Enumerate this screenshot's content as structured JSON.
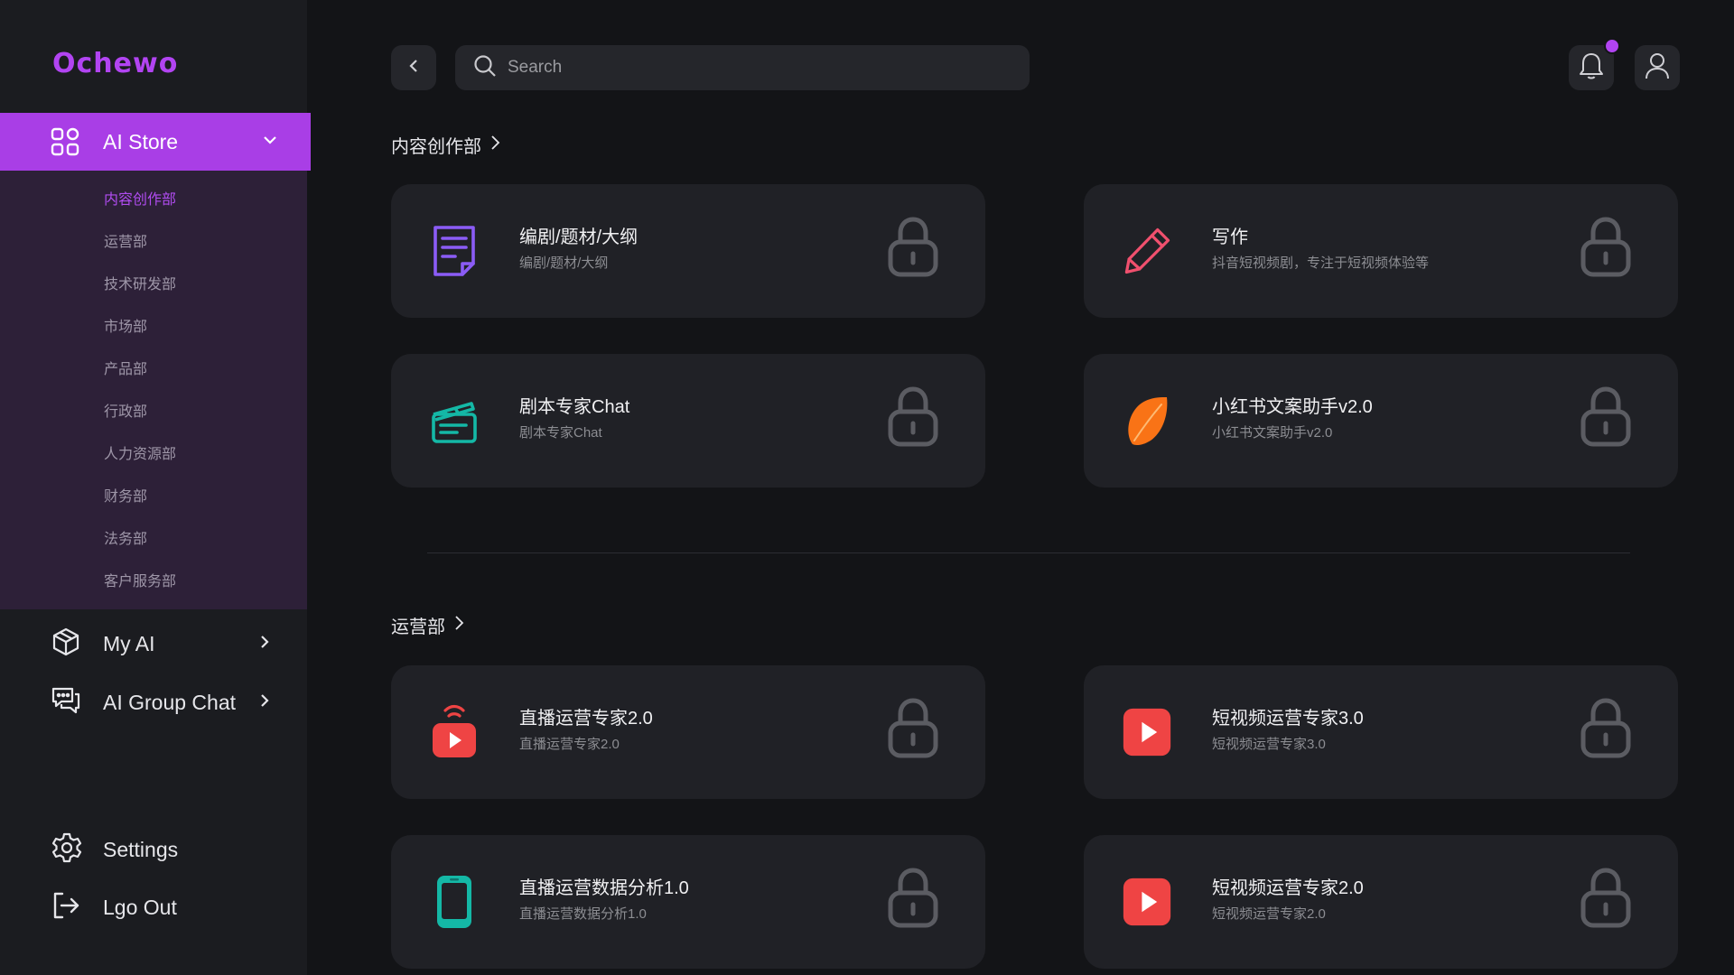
{
  "brand": {
    "logo": "Ochewo",
    "accent": "#b244f2"
  },
  "sidebar": {
    "ai_store": {
      "label": "AI Store"
    },
    "submenu": [
      {
        "label": "内容创作部",
        "active": true
      },
      {
        "label": "运营部"
      },
      {
        "label": "技术研发部"
      },
      {
        "label": "市场部"
      },
      {
        "label": "产品部"
      },
      {
        "label": "行政部"
      },
      {
        "label": "人力资源部"
      },
      {
        "label": "财务部"
      },
      {
        "label": "法务部"
      },
      {
        "label": "客户服务部"
      }
    ],
    "my_ai": {
      "label": "My AI"
    },
    "group_chat": {
      "label": "AI Group Chat"
    },
    "settings": {
      "label": "Settings"
    },
    "logout": {
      "label": "Lgo Out"
    }
  },
  "header": {
    "search_placeholder": "Search",
    "icons": [
      "back-icon",
      "search-icon",
      "bell-icon",
      "user-icon"
    ]
  },
  "sections": [
    {
      "title": "内容创作部",
      "cards": [
        {
          "title": "编剧/题材/大纲",
          "subtitle": "编剧/题材/大纲",
          "icon": "document-icon",
          "color": "#8b5cf6"
        },
        {
          "title": "写作",
          "subtitle": "抖音短视频剧，专注于短视频体验等",
          "icon": "pencil-icon",
          "color": "#f0506e"
        },
        {
          "title": "剧本专家Chat",
          "subtitle": "剧本专家Chat",
          "icon": "clapperboard-icon",
          "color": "#14b8a6"
        },
        {
          "title": "小红书文案助手v2.0",
          "subtitle": "小红书文案助手v2.0",
          "icon": "leaf-icon",
          "color": "#f97316"
        }
      ]
    },
    {
      "title": "运营部",
      "cards": [
        {
          "title": "直播运营专家2.0",
          "subtitle": "直播运营专家2.0",
          "icon": "live-broadcast-icon",
          "color": "#ef4444"
        },
        {
          "title": "短视频运营专家3.0",
          "subtitle": "短视频运营专家3.0",
          "icon": "video-play-icon",
          "color": "#ef4444"
        },
        {
          "title": "直播运营数据分析1.0",
          "subtitle": "直播运营数据分析1.0",
          "icon": "mobile-phone-icon",
          "color": "#14b8a6"
        },
        {
          "title": "短视频运营专家2.0",
          "subtitle": "短视频运营专家2.0",
          "icon": "video-play-icon",
          "color": "#ef4444"
        }
      ]
    }
  ]
}
